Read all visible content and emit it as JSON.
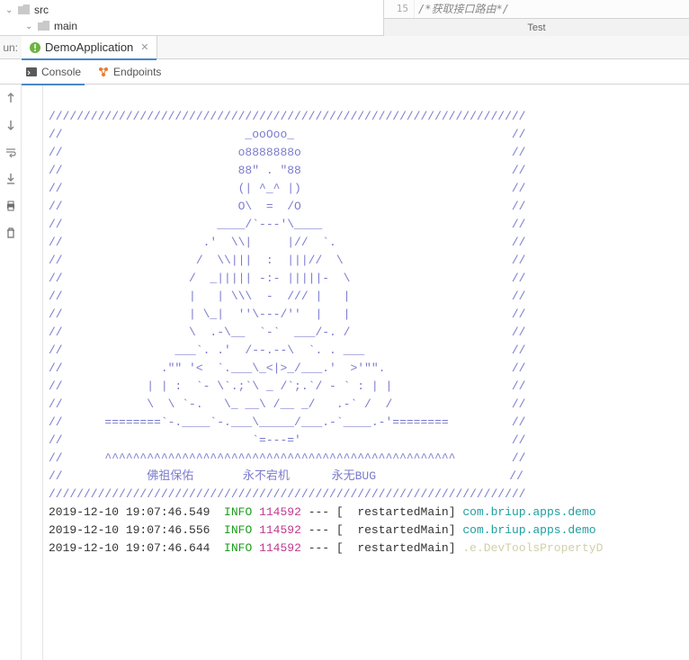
{
  "tree": {
    "src": "src",
    "main": "main"
  },
  "editor": {
    "lineNum": "15",
    "codeFragment": "/*获取接口路由*/",
    "testLabel": "Test"
  },
  "run": {
    "prefix": "un:",
    "appName": "DemoApplication"
  },
  "subtabs": {
    "console": "Console",
    "endpoints": "Endpoints"
  },
  "ascii": {
    "sep": "////////////////////////////////////////////////////////////////////",
    "l01": "//                          _ooOoo_                               //",
    "l02": "//                         o8888888o                              //",
    "l03": "//                         88\" . \"88                              //",
    "l04": "//                         (| ^_^ |)                              //",
    "l05": "//                         O\\  =  /O                              //",
    "l06": "//                      ____/`---'\\____                           //",
    "l07": "//                    .'  \\\\|     |//  `.                         //",
    "l08": "//                   /  \\\\|||  :  |||//  \\                        //",
    "l09": "//                  /  _||||| -:- |||||-  \\                       //",
    "l10": "//                  |   | \\\\\\  -  /// |   |                       //",
    "l11": "//                  | \\_|  ''\\---/''  |   |                       //",
    "l12": "//                  \\  .-\\__  `-`  ___/-. /                       //",
    "l13": "//                ___`. .'  /--.--\\  `. . ___                     //",
    "l14": "//              .\"\" '<  `.___\\_<|>_/___.'  >'\"\".                  //",
    "l15": "//            | | :  `- \\`.;`\\ _ /`;.`/ - ` : | |                 //",
    "l16": "//            \\  \\ `-.   \\_ __\\ /__ _/   .-` /  /                 //",
    "l17": "//      ========`-.____`-.___\\_____/___.-`____.-'========         //",
    "l18": "//                           `=---='                              //",
    "l19": "//      ^^^^^^^^^^^^^^^^^^^^^^^^^^^^^^^^^^^^^^^^^^^^^^^^^^        //",
    "l20": "//            佛祖保佑       永不宕机      永无BUG                   //"
  },
  "logs": [
    {
      "ts": "2019-12-10 19:07:46.549",
      "level": "INFO",
      "pid": "114592",
      "sep": "--- [",
      "thread": "  restartedMain]",
      "logger": "com.briup.apps.demo",
      "loggerCls": "logger1"
    },
    {
      "ts": "2019-12-10 19:07:46.556",
      "level": "INFO",
      "pid": "114592",
      "sep": "--- [",
      "thread": "  restartedMain]",
      "logger": "com.briup.apps.demo",
      "loggerCls": "logger1"
    },
    {
      "ts": "2019-12-10 19:07:46.644",
      "level": "INFO",
      "pid": "114592",
      "sep": "--- [",
      "thread": "  restartedMain]",
      "logger": ".e.DevToolsPropertyD",
      "loggerCls": "logger2"
    }
  ]
}
